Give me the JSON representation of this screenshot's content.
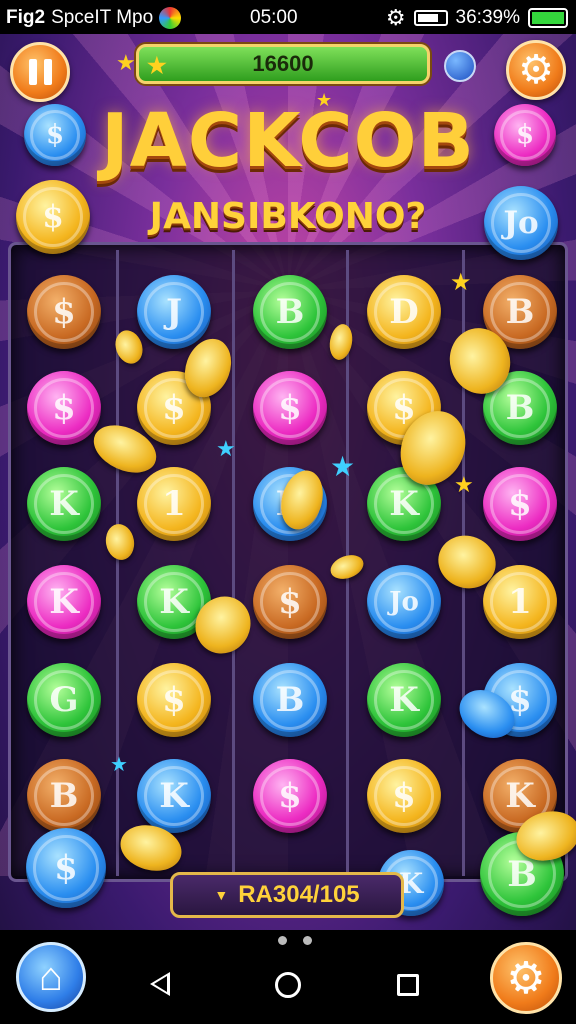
{
  "status_bar": {
    "app_label": "Fig2",
    "carrier_text": "SpceIT Mpo",
    "time": "05:00",
    "battery_text": "36:39%"
  },
  "hud": {
    "score": "16600",
    "pause_icon": "pause-icon",
    "settings_icon": "gear-icon"
  },
  "title": {
    "main": "JACKCOB",
    "sub": "JANSIBKONO?"
  },
  "board": {
    "columns": 5,
    "rows": [
      [
        {
          "type": "bronze",
          "glyph": "$"
        },
        {
          "type": "blue",
          "glyph": "J"
        },
        {
          "type": "green",
          "glyph": "B"
        },
        {
          "type": "gold",
          "glyph": "D"
        },
        {
          "type": "bronze",
          "glyph": "B"
        }
      ],
      [
        {
          "type": "pink",
          "glyph": "$"
        },
        {
          "type": "gold",
          "glyph": "$"
        },
        {
          "type": "pink",
          "glyph": "$"
        },
        {
          "type": "gold",
          "glyph": "$"
        },
        {
          "type": "green",
          "glyph": "B"
        }
      ],
      [
        {
          "type": "green",
          "glyph": "K"
        },
        {
          "type": "gold",
          "glyph": "1"
        },
        {
          "type": "blue",
          "glyph": "B"
        },
        {
          "type": "green",
          "glyph": "K"
        },
        {
          "type": "pink",
          "glyph": "$"
        }
      ],
      [
        {
          "type": "pink",
          "glyph": "K"
        },
        {
          "type": "green",
          "glyph": "K"
        },
        {
          "type": "bronze",
          "glyph": "$"
        },
        {
          "type": "blue",
          "glyph": "Jo"
        },
        {
          "type": "gold",
          "glyph": "1"
        }
      ],
      [
        {
          "type": "green",
          "glyph": "G"
        },
        {
          "type": "gold",
          "glyph": "$"
        },
        {
          "type": "blue",
          "glyph": "B"
        },
        {
          "type": "green",
          "glyph": "K"
        },
        {
          "type": "blue",
          "glyph": "$"
        }
      ],
      [
        {
          "type": "bronze",
          "glyph": "B"
        },
        {
          "type": "blue",
          "glyph": "K"
        },
        {
          "type": "pink",
          "glyph": "$"
        },
        {
          "type": "gold",
          "glyph": "$"
        },
        {
          "type": "bronze",
          "glyph": "K"
        }
      ]
    ]
  },
  "side_coins": [
    {
      "type": "blue",
      "glyph": "$"
    },
    {
      "type": "gold",
      "glyph": "$"
    },
    {
      "type": "pink",
      "glyph": "$"
    },
    {
      "type": "blue",
      "glyph": "Jo"
    },
    {
      "type": "blue",
      "glyph": "$"
    },
    {
      "type": "green",
      "glyph": "B"
    },
    {
      "type": "blue",
      "glyph": "K"
    }
  ],
  "counter": {
    "text": "RA304/105"
  },
  "nav": {
    "home_icon": "home-icon",
    "settings_icon": "gear-icon"
  },
  "colors": {
    "gold": "#f4b51e",
    "accent_green": "#2f9e1e",
    "frame": "#e4b84a"
  }
}
